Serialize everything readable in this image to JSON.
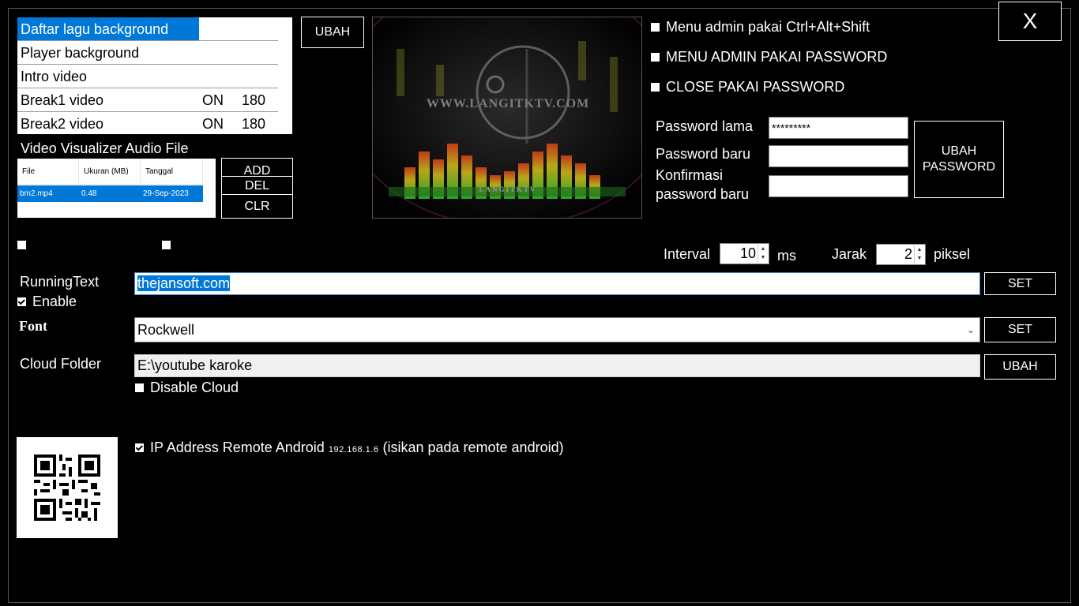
{
  "close_label": "X",
  "playlist": {
    "items": [
      {
        "name": "Daftar lagu background",
        "state": "",
        "value": ""
      },
      {
        "name": "Player background",
        "state": "",
        "value": ""
      },
      {
        "name": "Intro video",
        "state": "",
        "value": ""
      },
      {
        "name": "Break1 video",
        "state": "ON",
        "value": "180"
      },
      {
        "name": "Break2 video",
        "state": "ON",
        "value": "180"
      }
    ],
    "change_button": "UBAH"
  },
  "visualizer": {
    "title": "Video Visualizer Audio File",
    "columns": [
      "File",
      "Ukuran (MB)",
      "Tanggal"
    ],
    "rows": [
      {
        "file": "bm2.mp4",
        "size": "0.48",
        "date": "29-Sep-2023"
      }
    ],
    "buttons": {
      "add": "ADD",
      "del": "DEL",
      "clr": "CLR"
    }
  },
  "preview": {
    "watermark": "WWW.LANGITKTV.COM",
    "logo_text": "LANGITKTV"
  },
  "admin_options": [
    {
      "label": "Menu admin pakai Ctrl+Alt+Shift",
      "checked": false
    },
    {
      "label": "MENU ADMIN PAKAI PASSWORD",
      "checked": false
    },
    {
      "label": "CLOSE PAKAI PASSWORD",
      "checked": false
    }
  ],
  "password": {
    "old_label": "Password lama",
    "old_value": "*********",
    "new_label": "Password baru",
    "new_value": "",
    "confirm_label_line1": "Konfirmasi",
    "confirm_label_line2": "password baru",
    "confirm_value": "",
    "change_button_line1": "UBAH",
    "change_button_line2": "PASSWORD"
  },
  "interval": {
    "label": "Interval",
    "value": "10",
    "unit": "ms"
  },
  "jarak": {
    "label": "Jarak",
    "value": "2",
    "unit": "piksel"
  },
  "running_text": {
    "label": "RunningText",
    "value": "thejansoft.com",
    "enable_label": "Enable",
    "enable_checked": true,
    "set_button": "SET"
  },
  "font": {
    "label": "Font",
    "value": "Rockwell",
    "set_button": "SET"
  },
  "cloud": {
    "label": "Cloud Folder",
    "value": "E:\\youtube karoke",
    "change_button": "UBAH",
    "disable_label": "Disable Cloud",
    "disable_checked": false
  },
  "remote": {
    "label": "IP Address Remote Android",
    "ip": "192.168.1.6",
    "hint": "(isikan pada remote android)",
    "checked": true
  },
  "colors": {
    "selection": "#0078d7",
    "background": "#000000"
  }
}
